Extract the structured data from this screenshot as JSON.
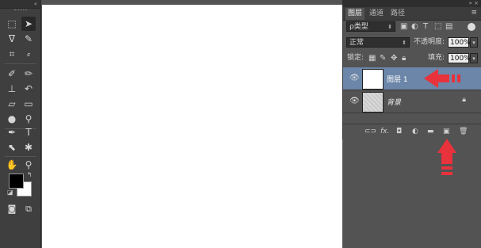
{
  "toolbar": {
    "tools": [
      {
        "name": "marquee-tool",
        "glyph": "⬚"
      },
      {
        "name": "move-tool",
        "glyph": "✥"
      },
      {
        "name": "lasso-tool",
        "glyph": "ᗢ"
      },
      {
        "name": "quick-select-tool",
        "glyph": "✎"
      },
      {
        "name": "crop-tool",
        "glyph": "⌗"
      },
      {
        "name": "eyedropper-tool",
        "glyph": "⸝"
      },
      {
        "name": "healing-tool",
        "glyph": "✐"
      },
      {
        "name": "brush-tool",
        "glyph": "✏"
      },
      {
        "name": "stamp-tool",
        "glyph": "⊥"
      },
      {
        "name": "history-brush-tool",
        "glyph": "↶"
      },
      {
        "name": "eraser-tool",
        "glyph": "⌫"
      },
      {
        "name": "gradient-tool",
        "glyph": "▭"
      },
      {
        "name": "blur-tool",
        "glyph": "●"
      },
      {
        "name": "dodge-tool",
        "glyph": "⚲"
      },
      {
        "name": "pen-tool",
        "glyph": "✒"
      },
      {
        "name": "type-tool",
        "glyph": "T"
      },
      {
        "name": "path-select-tool",
        "glyph": "⬉"
      },
      {
        "name": "shape-tool",
        "glyph": "✱"
      },
      {
        "name": "hand-tool",
        "glyph": "✋"
      },
      {
        "name": "zoom-tool",
        "glyph": "⚲"
      }
    ],
    "foreground_color": "#000000",
    "background_color": "#ffffff"
  },
  "panel": {
    "tabs": [
      "图层",
      "通道",
      "路径"
    ],
    "kind_filter": "ρ类型",
    "blend_mode": "正常",
    "opacity_label": "不透明度:",
    "opacity_value": "100%",
    "lock_label": "锁定:",
    "fill_label": "填充:",
    "fill_value": "100%",
    "layers": [
      {
        "name": "图层 1",
        "selected": true
      },
      {
        "name": "背景",
        "selected": false,
        "locked": true
      }
    ],
    "bottom_icons": [
      "link-icon",
      "fx-icon",
      "mask-icon",
      "adjustment-icon",
      "group-folder-icon",
      "new-layer-icon",
      "trash-icon"
    ],
    "fx_label": "fx."
  },
  "annotations": {
    "arrow_color": "#e8323c"
  }
}
